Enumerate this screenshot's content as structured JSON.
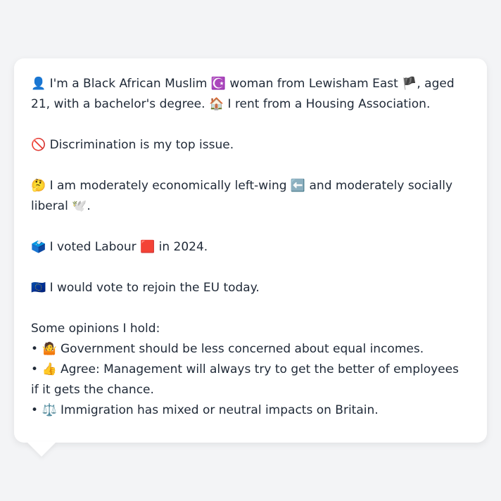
{
  "profile": {
    "intro": {
      "person_icon": "👤",
      "text1": " I'm a Black African Muslim ",
      "religion_icon": "☪️",
      "text2": " woman from Lewisham East ",
      "flag_icon": "🏴",
      "text3": ", aged 21, with a bachelor's degree. ",
      "house_icon": "🏠",
      "text4": " I rent from a Housing Association."
    },
    "top_issue": {
      "icon": "🚫",
      "text": " Discrimination is my top issue."
    },
    "ideology": {
      "icon": "🤔",
      "text1": " I am moderately economically left-wing ",
      "left_icon": "⬅️",
      "text2": " and moderately socially liberal ",
      "dove_icon": "🕊️",
      "text3": "."
    },
    "vote": {
      "icon": "🗳️",
      "text1": " I voted Labour ",
      "party_icon": "🟥",
      "text2": " in 2024."
    },
    "eu": {
      "icon": "🇪🇺",
      "text": " I would vote to rejoin the EU today."
    },
    "opinions_heading": "Some opinions I hold:",
    "opinions": [
      {
        "bullet": "• ",
        "icon": "🤷",
        "text": " Government should be less concerned about equal incomes."
      },
      {
        "bullet": "• ",
        "icon": "👍",
        "text": " Agree: Management will always try to get the better of employees if it gets the chance."
      },
      {
        "bullet": "• ",
        "icon": "⚖️",
        "text": " Immigration has mixed or neutral impacts on Britain."
      }
    ]
  }
}
